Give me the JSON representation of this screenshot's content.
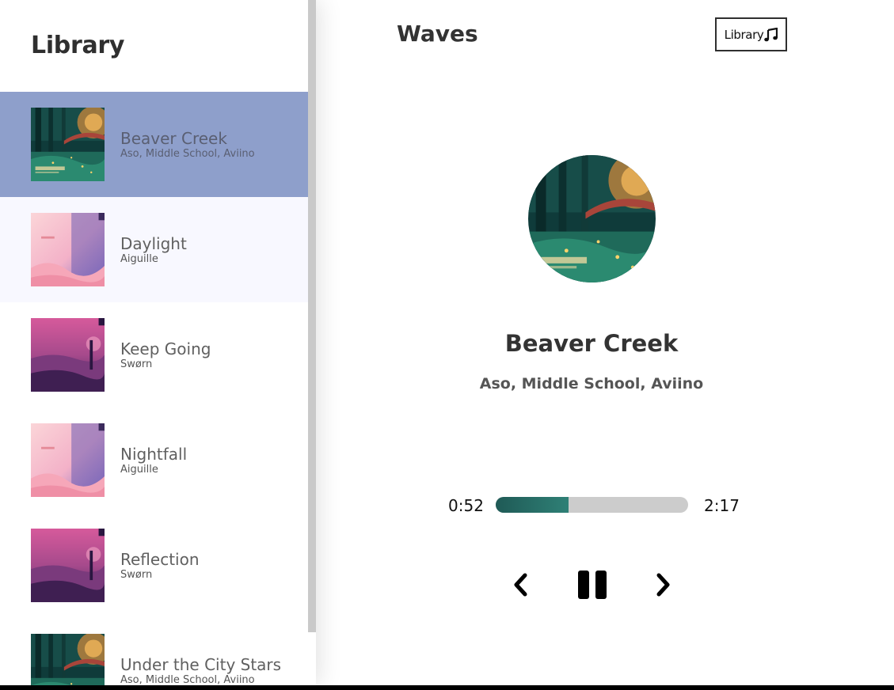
{
  "library": {
    "title": "Library",
    "songs": [
      {
        "name": "Beaver Creek",
        "artist": "Aso, Middle School, Aviino",
        "cover": "forest",
        "state": "selected"
      },
      {
        "name": "Daylight",
        "artist": "Aiguille",
        "cover": "pink",
        "state": "hover"
      },
      {
        "name": "Keep Going",
        "artist": "Swørn",
        "cover": "magenta",
        "state": ""
      },
      {
        "name": "Nightfall",
        "artist": "Aiguille",
        "cover": "pink",
        "state": ""
      },
      {
        "name": "Reflection",
        "artist": "Swørn",
        "cover": "magenta",
        "state": ""
      },
      {
        "name": "Under the City Stars",
        "artist": "Aso, Middle School, Aviino",
        "cover": "forest",
        "state": ""
      }
    ]
  },
  "header": {
    "title": "Waves",
    "library_button_label": "Library",
    "library_button_icon": "music-note-icon"
  },
  "player": {
    "cover": "forest",
    "song_name": "Beaver Creek",
    "artist": "Aso, Middle School, Aviino",
    "current_time": "0:52",
    "total_time": "2:17",
    "progress": 0.38,
    "controls": [
      "chevron-left-icon",
      "pause-icon",
      "chevron-right-icon"
    ]
  },
  "colors": {
    "selected_song_bg": "#8e9fcb",
    "hover_song_bg": "#f8f8ff",
    "progress_fill": "#2a6e67",
    "progress_track": "#cccccc"
  }
}
